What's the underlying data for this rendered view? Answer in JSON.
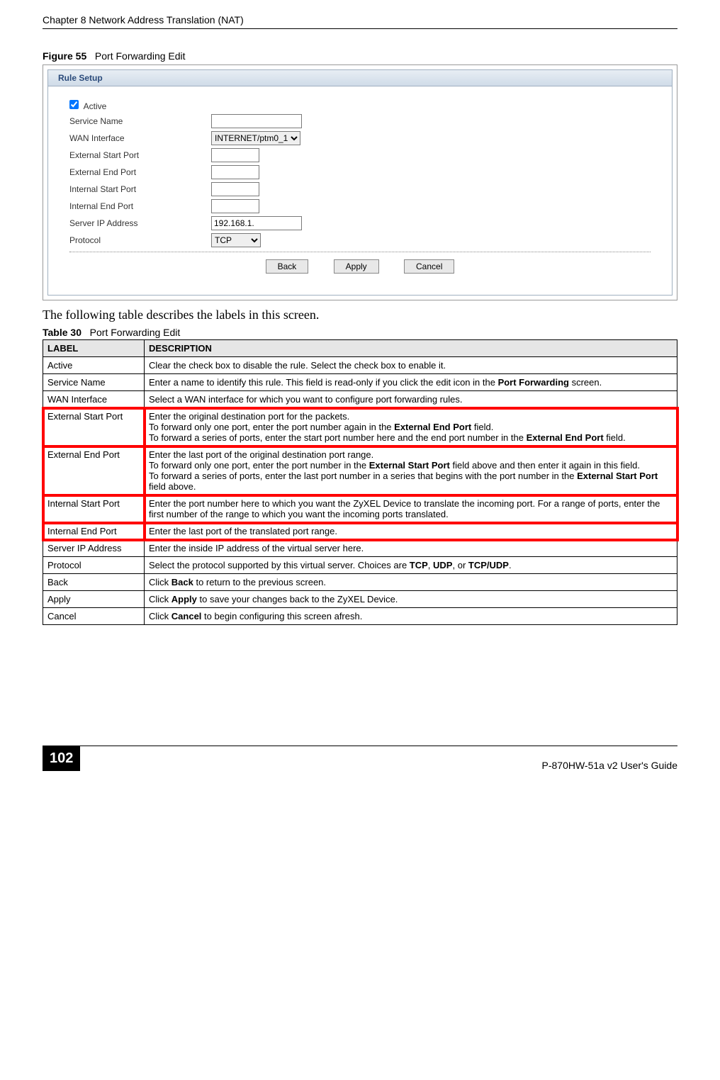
{
  "header": {
    "chapter": "Chapter 8 Network Address Translation (NAT)"
  },
  "figure": {
    "label": "Figure 55",
    "title": "Port Forwarding Edit"
  },
  "screenshot": {
    "pane_title": "Rule Setup",
    "rows": {
      "active_label": "Active",
      "service_name_label": "Service Name",
      "wan_iface_label": "WAN Interface",
      "wan_iface_value": "INTERNET/ptm0_1",
      "ext_start_label": "External Start Port",
      "ext_end_label": "External End Port",
      "int_start_label": "Internal Start Port",
      "int_end_label": "Internal End Port",
      "server_ip_label": "Server IP Address",
      "server_ip_value": "192.168.1.",
      "protocol_label": "Protocol",
      "protocol_value": "TCP"
    },
    "buttons": {
      "back": "Back",
      "apply": "Apply",
      "cancel": "Cancel"
    }
  },
  "para": "The following table describes the labels in this screen.",
  "table_caption": {
    "label": "Table 30",
    "title": "Port Forwarding Edit"
  },
  "table_headers": {
    "label": "LABEL",
    "desc": "DESCRIPTION"
  },
  "rows": [
    {
      "label": "Active",
      "desc": "Clear the check box to disable the rule. Select the check box to enable it.",
      "hl": false
    },
    {
      "label": "Service Name",
      "desc": "Enter a name to identify this rule. This field is read-only if you click the edit icon in the <b>Port Forwarding</b> screen.",
      "hl": false
    },
    {
      "label": "WAN Interface",
      "desc": "Select a WAN interface for which you want to configure port forwarding rules.",
      "hl": false
    },
    {
      "label": "External Start Port",
      "desc": "Enter the original destination port for the packets.<br>To forward only one port, enter the port number again in the <b>External End Port</b> field.<br>To forward a series of ports, enter the start port number here and the end port number in the <b>External End Port</b> field.",
      "hl": true
    },
    {
      "label": "External End Port",
      "desc": "Enter the last port of the original destination port range.<br>To forward only one port, enter the port number in the <b>External Start Port</b> field above and then enter it again in this field.<br>To forward a series of ports, enter the last port number in a series that begins with the port number in the <b>External Start Port</b> field above.",
      "hl": true
    },
    {
      "label": "Internal Start Port",
      "desc": "Enter the port number here to which you want the ZyXEL Device to translate the incoming port. For a range of ports, enter the first number of the range to which you want the incoming ports translated.",
      "hl": true
    },
    {
      "label": "Internal End Port",
      "desc": "Enter the last port of the translated port range.",
      "hl": true
    },
    {
      "label": "Server IP Address",
      "desc": "Enter the inside IP address of the virtual server here.",
      "hl": false
    },
    {
      "label": "Protocol",
      "desc": "Select the protocol supported by this virtual server. Choices are <b>TCP</b>, <b>UDP</b>, or <b>TCP/UDP</b>.",
      "hl": false
    },
    {
      "label": "Back",
      "desc": "Click <b>Back</b> to return to the previous screen.",
      "hl": false
    },
    {
      "label": "Apply",
      "desc": "Click <b>Apply</b> to save your changes back to the ZyXEL Device.",
      "hl": false
    },
    {
      "label": "Cancel",
      "desc": "Click <b>Cancel</b> to begin configuring this screen afresh.",
      "hl": false
    }
  ],
  "footer": {
    "page": "102",
    "guide": "P-870HW-51a v2 User's Guide"
  }
}
